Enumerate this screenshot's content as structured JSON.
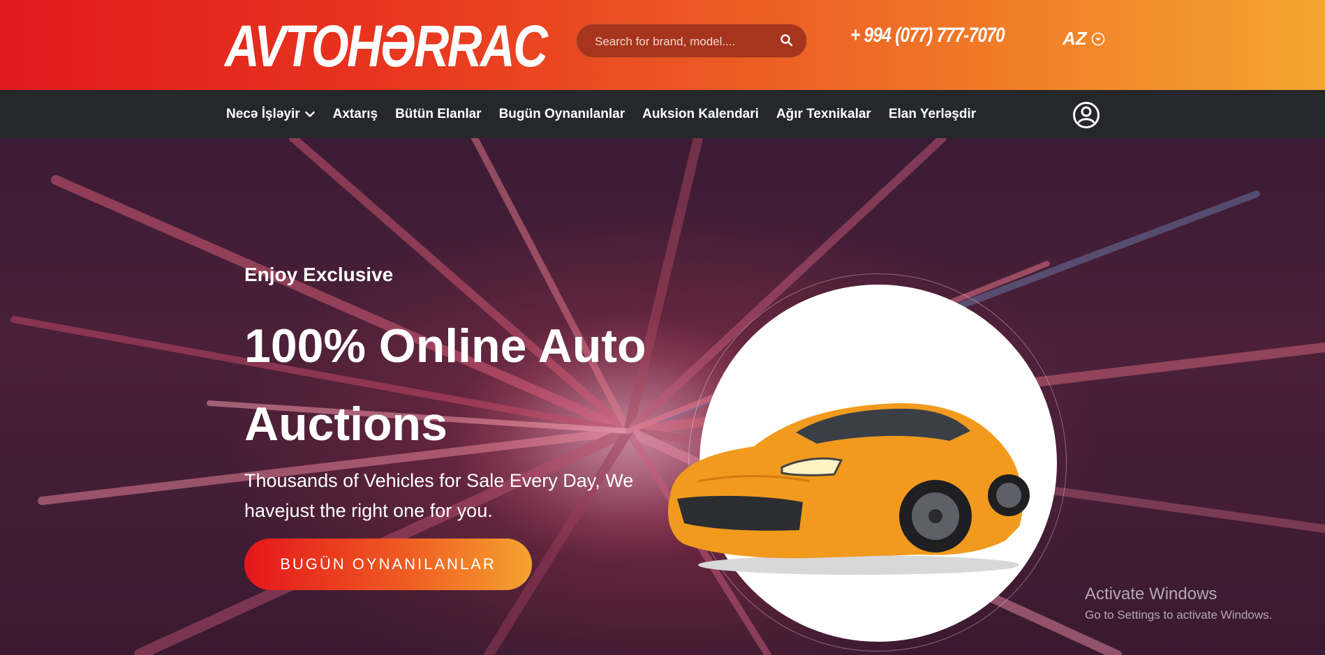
{
  "header": {
    "logo_text": "AVTOHƏRRAC",
    "search_placeholder": "Search for brand, model....",
    "phone": "+ 994 (077) 777-7070",
    "language": "AZ"
  },
  "nav": {
    "items": [
      {
        "label": "Necə İşləyir",
        "has_dropdown": true
      },
      {
        "label": "Axtarış"
      },
      {
        "label": "Bütün Elanlar"
      },
      {
        "label": "Bugün Oynanılanlar"
      },
      {
        "label": "Auksion Kalendari"
      },
      {
        "label": "Ağır Texnikalar"
      },
      {
        "label": "Elan Yerləşdir"
      }
    ]
  },
  "hero": {
    "eyebrow": "Enjoy Exclusive",
    "headline": "100% Online Auto Auctions",
    "subtext": "Thousands of Vehicles for Sale Every Day, We havejust the right one for you.",
    "cta_label": "BUGÜN OYNANILANLAR"
  },
  "watermark": {
    "title": "Activate Windows",
    "subtitle": "Go to Settings to activate Windows."
  },
  "colors": {
    "header_start": "#df1a1c",
    "header_end": "#f5a530",
    "nav_bg": "#25272a",
    "car": "#f29a1e"
  }
}
